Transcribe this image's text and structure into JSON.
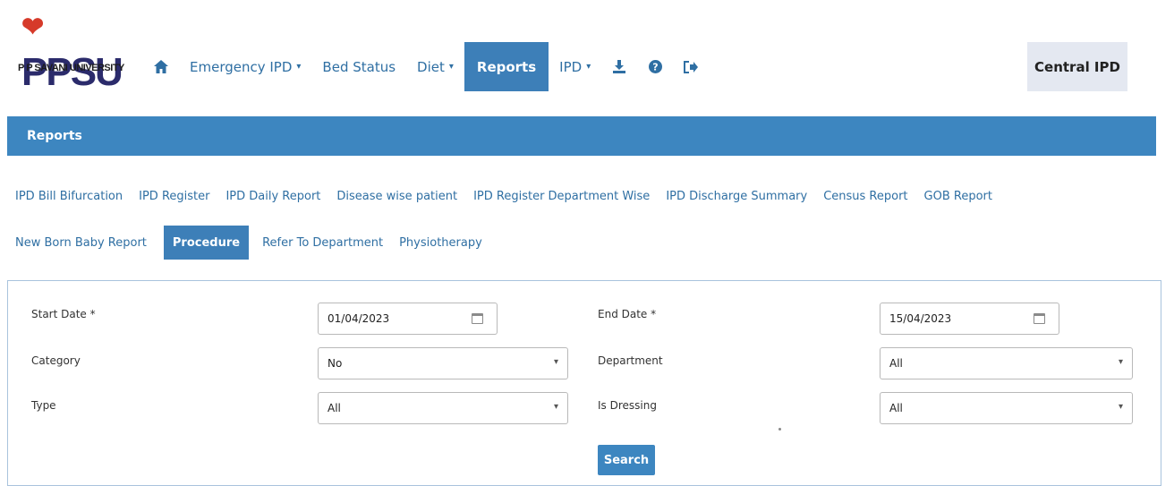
{
  "brand": {
    "logo_text": "PPSU",
    "sub_text": "P P SAVANI UNIVERSITY"
  },
  "nav": {
    "home_icon": "home-icon",
    "emergency": "Emergency IPD",
    "bed_status": "Bed Status",
    "diet": "Diet",
    "reports": "Reports",
    "ipd": "IPD",
    "download_icon": "download-icon",
    "help_icon": "help-icon",
    "logout_icon": "logout-icon",
    "caret": "▾"
  },
  "central_ipd": "Central IPD",
  "section_title": "Reports",
  "tabs_row1": [
    "IPD Bill Bifurcation",
    "IPD Register",
    "IPD Daily Report",
    "Disease wise patient",
    "IPD Register Department Wise",
    "IPD Discharge Summary",
    "Census Report",
    "GOB Report"
  ],
  "tabs_row2": [
    "New Born Baby Report",
    "Procedure",
    "Refer To Department",
    "Physiotherapy"
  ],
  "form": {
    "start_date_label": "Start Date *",
    "start_date_value": "01/04/2023",
    "end_date_label": "End Date *",
    "end_date_value": "15/04/2023",
    "category_label": "Category",
    "category_value": "No",
    "department_label": "Department",
    "department_value": "All",
    "type_label": "Type",
    "type_value": "All",
    "dressing_label": "Is Dressing",
    "dressing_value": "All",
    "search_label": "Search"
  },
  "colors": {
    "accent": "#3d86c0",
    "link": "#2f6fa3",
    "central_bg": "#e4e8f1"
  }
}
